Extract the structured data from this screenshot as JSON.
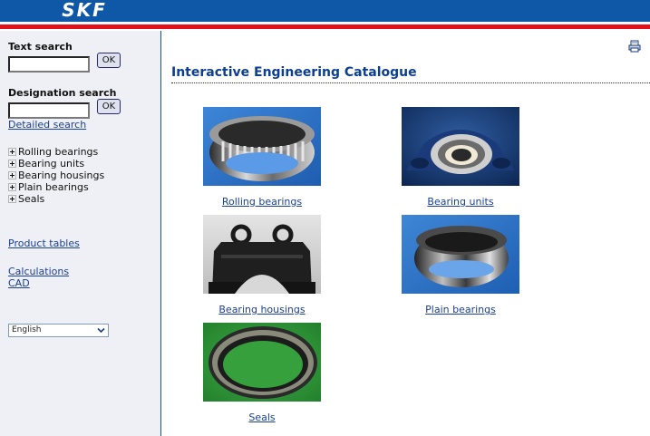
{
  "header": {
    "logo_text": "SKF",
    "colors": {
      "bar": "#0f58a8",
      "stripe": "#e2101a"
    }
  },
  "sidebar": {
    "text_search_label": "Text search",
    "text_search_value": "",
    "text_search_button": "OK",
    "designation_search_label": "Designation search",
    "designation_search_value": "",
    "designation_search_button": "OK",
    "detailed_search_link": "Detailed search",
    "tree": [
      {
        "label": "Rolling bearings",
        "icon": "expand-plus-icon"
      },
      {
        "label": "Bearing units",
        "icon": "expand-plus-icon"
      },
      {
        "label": "Bearing housings",
        "icon": "expand-plus-icon"
      },
      {
        "label": "Plain bearings",
        "icon": "expand-plus-icon"
      },
      {
        "label": "Seals",
        "icon": "expand-plus-icon"
      }
    ],
    "product_tables_link": "Product tables",
    "calculations_link": "Calculations",
    "cad_link": "CAD",
    "language": "English"
  },
  "main": {
    "print_icon": "printer-icon",
    "title": "Interactive Engineering Catalogue",
    "tiles": [
      {
        "label": "Rolling bearings",
        "image": "rolling-bearing-photo"
      },
      {
        "label": "Bearing units",
        "image": "bearing-unit-photo"
      },
      {
        "label": "Bearing housings",
        "image": "bearing-housing-photo"
      },
      {
        "label": "Plain bearings",
        "image": "plain-bearing-photo"
      },
      {
        "label": "Seals",
        "image": "seal-photo"
      }
    ]
  }
}
